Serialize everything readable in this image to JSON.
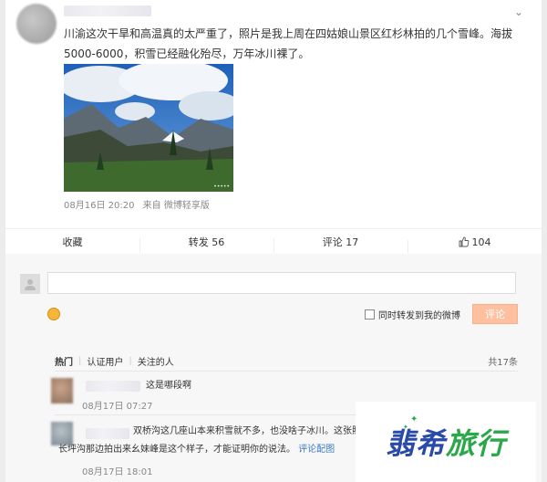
{
  "post": {
    "text_line1": "川渝这次干旱和高温真的太严重了，照片是我上周在四姑娘山景区红杉林拍的几个雪峰。海拔",
    "text_line2": "5000-6000，积雪已经融化殆尽，万年冰川裸了。",
    "date": "08月16日 20:20",
    "source": "来自 微博轻享版"
  },
  "actions": {
    "favorite": "收藏",
    "repost": "转发 56",
    "comment": "评论 17",
    "like": "104"
  },
  "composer": {
    "forward_label": "同时转发到我的微博",
    "submit_label": "评论"
  },
  "filters": {
    "tabs": [
      "热门",
      "认证用户",
      "关注的人"
    ],
    "total": "共17条"
  },
  "comments": [
    {
      "text": "这是哪段啊",
      "time": "08月17日 07:27"
    },
    {
      "text_line1": "双桥沟这几座山本来积雪就不多，也没啥子冰川。这张照",
      "text_line2": "长坪沟那边拍出来幺妹峰是这个样子，才能证明你的说法。",
      "link": "评论配图",
      "time": "08月17日 18:01"
    }
  ],
  "watermark": {
    "part1": "翡希",
    "part2": "旅行"
  },
  "colors": {
    "accent": "#ff8140",
    "link": "#3f7bbf",
    "brand_blue": "#2a4aa8",
    "brand_green": "#2aa84a"
  }
}
